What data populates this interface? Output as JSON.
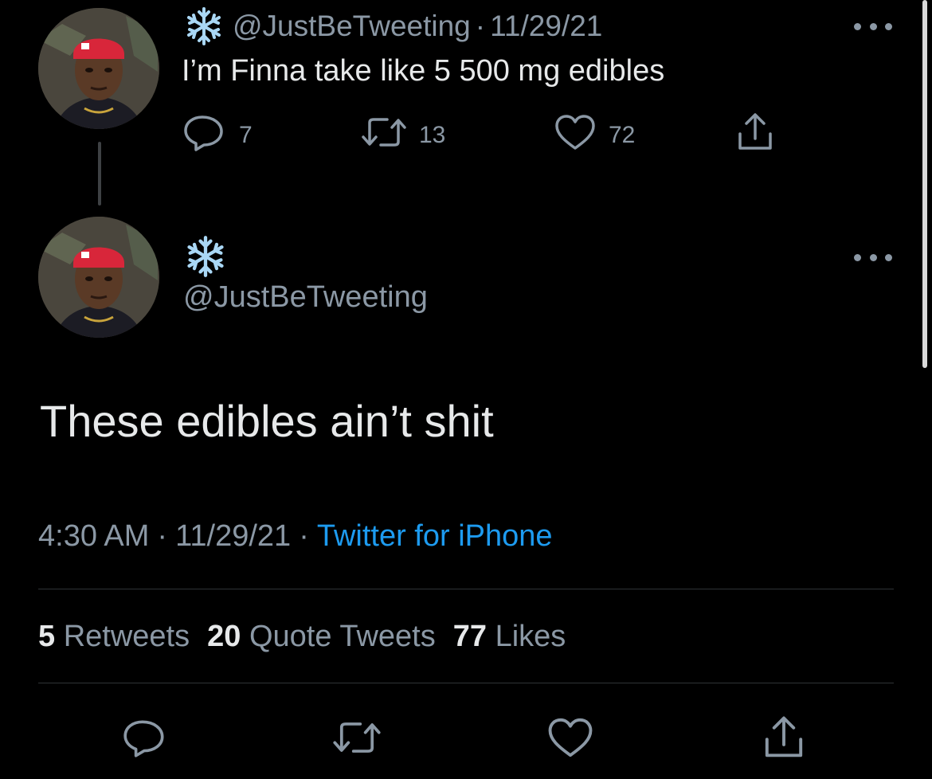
{
  "parent_tweet": {
    "handle": "@JustBeTweeting",
    "date": "11/29/21",
    "separator": "·",
    "text": "I’m Finna take like 5 500 mg edibles",
    "reply_count": "7",
    "retweet_count": "13",
    "like_count": "72",
    "icons": [
      "snowflake-emoji",
      "reply-icon",
      "retweet-icon",
      "heart-icon",
      "share-icon",
      "more-icon"
    ]
  },
  "main_tweet": {
    "handle": "@JustBeTweeting",
    "text": "These edibles ain’t shit",
    "time": "4:30 AM",
    "date": "11/29/21",
    "separator": "·",
    "source": "Twitter for iPhone",
    "retweets_count": "5",
    "retweets_label": "Retweets",
    "quote_count": "20",
    "quote_label": "Quote Tweets",
    "likes_count": "77",
    "likes_label": "Likes",
    "icons": [
      "snowflake-emoji",
      "reply-icon",
      "retweet-icon",
      "heart-icon",
      "share-icon",
      "more-icon"
    ]
  },
  "colors": {
    "background": "#000000",
    "primary_text": "#e7e9ea",
    "secondary_text": "#8b98a5",
    "link": "#1d9bf0",
    "divider": "#2f3336",
    "cap_red": "#d8263a"
  }
}
